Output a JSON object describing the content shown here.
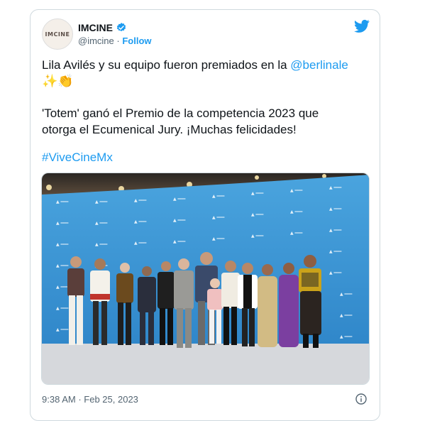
{
  "account": {
    "display_name": "IMCINE",
    "handle": "@imcine",
    "separator": "·",
    "follow_label": "Follow",
    "avatar_text": "IMCINE"
  },
  "tweet": {
    "line1_text": "Lila Avilés y su equipo fueron premiados en la ",
    "mention": "@berlinale",
    "emojis": "✨👏",
    "line2": "'Totem' ganó el Premio de la competencia 2023 que",
    "line3": "otorga el Ecumenical Jury. ¡Muchas felicidades!",
    "hashtag": "#ViveCineMx"
  },
  "meta": {
    "time": "9:38 AM",
    "separator": "·",
    "date": "Feb 25, 2023"
  },
  "colors": {
    "link": "#1d9bf0",
    "backdrop": "#3f9bd8"
  },
  "icons": [
    "verified-badge-icon",
    "twitter-bird-icon",
    "info-icon"
  ]
}
